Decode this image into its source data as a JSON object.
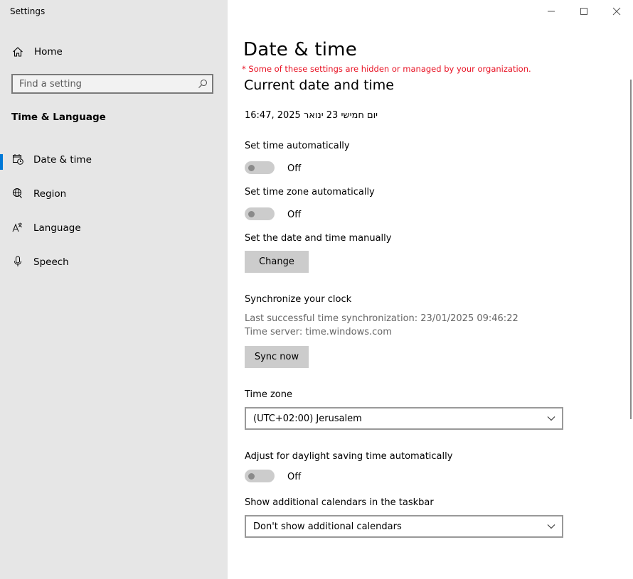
{
  "window": {
    "title": "Settings",
    "controls": {
      "minimize": "minimize-icon",
      "maximize": "maximize-icon",
      "close": "close-icon"
    }
  },
  "sidebar": {
    "home_label": "Home",
    "search": {
      "placeholder": "Find a setting"
    },
    "section_heading": "Time & Language",
    "items": [
      {
        "label": "Date & time",
        "icon": "date-time-icon",
        "selected": true
      },
      {
        "label": "Region",
        "icon": "globe-icon",
        "selected": false
      },
      {
        "label": "Language",
        "icon": "language-icon",
        "selected": false
      },
      {
        "label": "Speech",
        "icon": "microphone-icon",
        "selected": false
      }
    ]
  },
  "main": {
    "title": "Date & time",
    "org_warning": "* Some of these settings are hidden or managed by your organization.",
    "subheading": "Current date and time",
    "current_datetime": "16:47, 2025 יום חמישי 23 ינואר",
    "set_time_auto": {
      "label": "Set time automatically",
      "state": "Off"
    },
    "set_timezone_auto": {
      "label": "Set time zone automatically",
      "state": "Off"
    },
    "manual": {
      "label": "Set the date and time manually",
      "button": "Change"
    },
    "sync": {
      "label": "Synchronize your clock",
      "last_sync": "Last successful time synchronization: 23/01/2025 09:46:22",
      "server": "Time server: time.windows.com",
      "button": "Sync now"
    },
    "timezone": {
      "label": "Time zone",
      "value": "(UTC+02:00) Jerusalem"
    },
    "dst": {
      "label": "Adjust for daylight saving time automatically",
      "state": "Off"
    },
    "calendars": {
      "label": "Show additional calendars in the taskbar",
      "value": "Don't show additional calendars"
    }
  },
  "colors": {
    "accent": "#0078d7",
    "warning": "#e81123",
    "sidebar_bg": "#e6e6e6"
  }
}
